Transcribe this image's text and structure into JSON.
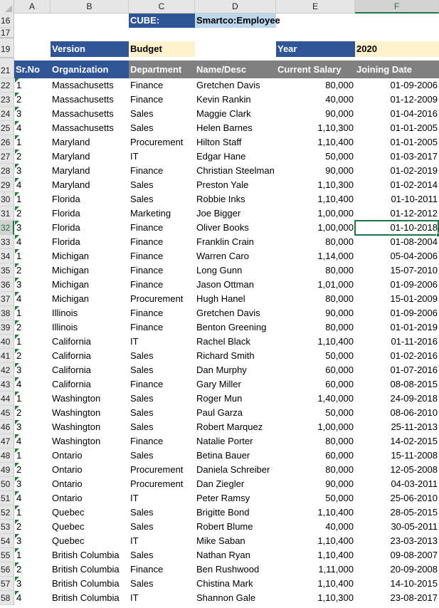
{
  "columns": [
    "A",
    "B",
    "C",
    "D",
    "E",
    "F"
  ],
  "active_column": "F",
  "active_row": "32",
  "header_rows": {
    "r16": "16",
    "r17": "17",
    "r19": "19",
    "r21": "21"
  },
  "cube": {
    "label": "CUBE:",
    "value": "Smartco:Employee"
  },
  "version": {
    "label": "Version",
    "value": "Budget"
  },
  "year": {
    "label": "Year",
    "value": "2020"
  },
  "table": {
    "headers": {
      "srno": "Sr.No",
      "organization": "Organization",
      "department": "Department",
      "name": "Name/Desc",
      "salary": "Current Salary",
      "joining": "Joining Date"
    },
    "rows": [
      {
        "row": "22",
        "srno": "1",
        "org": "Massachusetts",
        "dept": "Finance",
        "name": "Gretchen Davis",
        "salary": "80,000",
        "date": "01-09-2006"
      },
      {
        "row": "23",
        "srno": "2",
        "org": "Massachusetts",
        "dept": "Finance",
        "name": "Kevin Rankin",
        "salary": "40,000",
        "date": "01-12-2009"
      },
      {
        "row": "24",
        "srno": "3",
        "org": "Massachusetts",
        "dept": "Sales",
        "name": "Maggie Clark",
        "salary": "90,000",
        "date": "01-04-2016"
      },
      {
        "row": "25",
        "srno": "4",
        "org": "Massachusetts",
        "dept": "Sales",
        "name": "Helen Barnes",
        "salary": "1,10,300",
        "date": "01-01-2005"
      },
      {
        "row": "26",
        "srno": "1",
        "org": "Maryland",
        "dept": "Procurement",
        "name": "Hilton Staff",
        "salary": "1,10,400",
        "date": "01-01-2005"
      },
      {
        "row": "27",
        "srno": "2",
        "org": "Maryland",
        "dept": "IT",
        "name": "Edgar Hane",
        "salary": "50,000",
        "date": "01-03-2017"
      },
      {
        "row": "28",
        "srno": "3",
        "org": "Maryland",
        "dept": "Finance",
        "name": "Christian Steelman",
        "salary": "90,000",
        "date": "01-02-2019"
      },
      {
        "row": "29",
        "srno": "4",
        "org": "Maryland",
        "dept": "Sales",
        "name": "Preston Yale",
        "salary": "1,10,300",
        "date": "01-02-2014"
      },
      {
        "row": "30",
        "srno": "1",
        "org": "Florida",
        "dept": "Sales",
        "name": "Robbie Inks",
        "salary": "1,10,400",
        "date": "01-10-2011"
      },
      {
        "row": "31",
        "srno": "2",
        "org": "Florida",
        "dept": "Marketing",
        "name": "Joe Bigger",
        "salary": "1,00,000",
        "date": "01-12-2012"
      },
      {
        "row": "32",
        "srno": "3",
        "org": "Florida",
        "dept": "Finance",
        "name": "Oliver Books",
        "salary": "1,00,000",
        "date": "01-10-2018"
      },
      {
        "row": "33",
        "srno": "4",
        "org": "Florida",
        "dept": "Finance",
        "name": "Franklin Crain",
        "salary": "80,000",
        "date": "01-08-2004"
      },
      {
        "row": "34",
        "srno": "1",
        "org": "Michigan",
        "dept": "Finance",
        "name": "Warren Caro",
        "salary": "1,14,000",
        "date": "05-04-2006"
      },
      {
        "row": "35",
        "srno": "2",
        "org": "Michigan",
        "dept": "Finance",
        "name": "Long Gunn",
        "salary": "80,000",
        "date": "15-07-2010"
      },
      {
        "row": "36",
        "srno": "3",
        "org": "Michigan",
        "dept": "Finance",
        "name": "Jason Ottman",
        "salary": "1,01,000",
        "date": "01-09-2006"
      },
      {
        "row": "37",
        "srno": "4",
        "org": "Michigan",
        "dept": "Procurement",
        "name": "Hugh Hanel",
        "salary": "80,000",
        "date": "15-01-2009"
      },
      {
        "row": "38",
        "srno": "1",
        "org": "Illinois",
        "dept": "Finance",
        "name": "Gretchen Davis",
        "salary": "90,000",
        "date": "01-09-2006"
      },
      {
        "row": "39",
        "srno": "2",
        "org": "Illinois",
        "dept": "Finance",
        "name": "Benton Greening",
        "salary": "80,000",
        "date": "01-01-2019"
      },
      {
        "row": "40",
        "srno": "1",
        "org": "California",
        "dept": "IT",
        "name": "Rachel Black",
        "salary": "1,10,400",
        "date": "01-11-2016"
      },
      {
        "row": "41",
        "srno": "2",
        "org": "California",
        "dept": "Sales",
        "name": "Richard Smith",
        "salary": "50,000",
        "date": "01-02-2016"
      },
      {
        "row": "42",
        "srno": "3",
        "org": "California",
        "dept": "Sales",
        "name": "Dan Murphy",
        "salary": "60,000",
        "date": "01-07-2016"
      },
      {
        "row": "43",
        "srno": "4",
        "org": "California",
        "dept": "Finance",
        "name": "Gary Miller",
        "salary": "60,000",
        "date": "08-08-2015"
      },
      {
        "row": "44",
        "srno": "1",
        "org": "Washington",
        "dept": "Sales",
        "name": "Roger Mun",
        "salary": "1,40,000",
        "date": "24-09-2018"
      },
      {
        "row": "45",
        "srno": "2",
        "org": "Washington",
        "dept": "Sales",
        "name": "Paul Garza",
        "salary": "50,000",
        "date": "08-06-2010"
      },
      {
        "row": "46",
        "srno": "3",
        "org": "Washington",
        "dept": "Sales",
        "name": "Robert Marquez",
        "salary": "1,00,000",
        "date": "25-11-2013"
      },
      {
        "row": "47",
        "srno": "4",
        "org": "Washington",
        "dept": "Finance",
        "name": "Natalie Porter",
        "salary": "80,000",
        "date": "14-02-2015"
      },
      {
        "row": "48",
        "srno": "1",
        "org": "Ontario",
        "dept": "Sales",
        "name": "Betina Bauer",
        "salary": "60,000",
        "date": "15-11-2008"
      },
      {
        "row": "49",
        "srno": "2",
        "org": "Ontario",
        "dept": "Procurement",
        "name": "Daniela Schreiber",
        "salary": "80,000",
        "date": "12-05-2008"
      },
      {
        "row": "50",
        "srno": "3",
        "org": "Ontario",
        "dept": "Procurement",
        "name": "Dan Ziegler",
        "salary": "90,000",
        "date": "04-03-2011"
      },
      {
        "row": "51",
        "srno": "4",
        "org": "Ontario",
        "dept": "IT",
        "name": "Peter Ramsy",
        "salary": "50,000",
        "date": "25-06-2010"
      },
      {
        "row": "52",
        "srno": "1",
        "org": "Quebec",
        "dept": "Sales",
        "name": "Brigitte Bond",
        "salary": "1,10,400",
        "date": "28-05-2015"
      },
      {
        "row": "53",
        "srno": "2",
        "org": "Quebec",
        "dept": "Sales",
        "name": "Robert Blume",
        "salary": "40,000",
        "date": "30-05-2011"
      },
      {
        "row": "54",
        "srno": "3",
        "org": "Quebec",
        "dept": "IT",
        "name": "Mike Saban",
        "salary": "1,10,400",
        "date": "23-03-2013"
      },
      {
        "row": "55",
        "srno": "1",
        "org": "British Columbia",
        "dept": "Sales",
        "name": "Nathan Ryan",
        "salary": "1,10,400",
        "date": "09-08-2007"
      },
      {
        "row": "56",
        "srno": "2",
        "org": "British Columbia",
        "dept": "Finance",
        "name": "Ben Rushwood",
        "salary": "1,11,000",
        "date": "20-09-2008"
      },
      {
        "row": "57",
        "srno": "3",
        "org": "British Columbia",
        "dept": "Sales",
        "name": "Chistina Mark",
        "salary": "1,10,400",
        "date": "14-10-2015"
      },
      {
        "row": "58",
        "srno": "4",
        "org": "British Columbia",
        "dept": "IT",
        "name": "Shannon Gale",
        "salary": "1,10,300",
        "date": "23-08-2017"
      }
    ]
  },
  "colors": {
    "navy": "#2f5597",
    "grey_header": "#808080",
    "light_blue": "#bdd7ee",
    "cream": "#fff2cc",
    "excel_green": "#217346"
  }
}
